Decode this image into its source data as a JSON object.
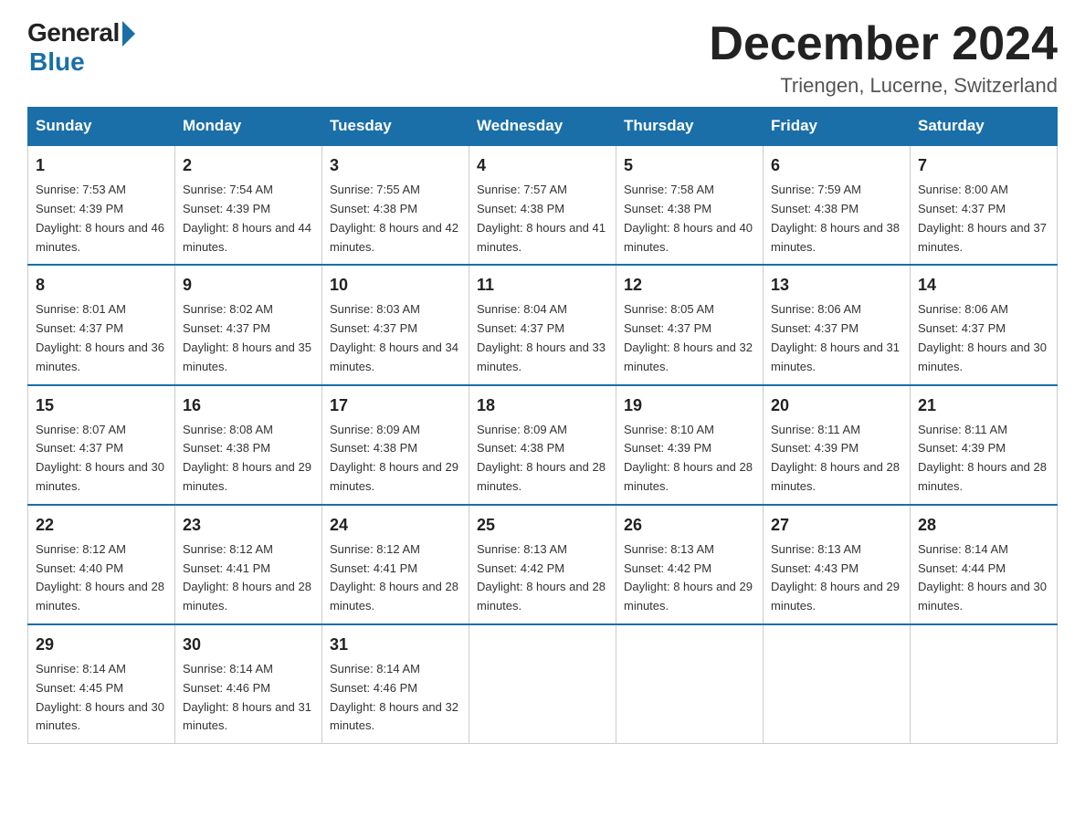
{
  "header": {
    "logo_general": "General",
    "logo_blue": "Blue",
    "month_title": "December 2024",
    "location": "Triengen, Lucerne, Switzerland"
  },
  "weekdays": [
    "Sunday",
    "Monday",
    "Tuesday",
    "Wednesday",
    "Thursday",
    "Friday",
    "Saturday"
  ],
  "weeks": [
    [
      {
        "day": "1",
        "sunrise": "7:53 AM",
        "sunset": "4:39 PM",
        "daylight": "8 hours and 46 minutes."
      },
      {
        "day": "2",
        "sunrise": "7:54 AM",
        "sunset": "4:39 PM",
        "daylight": "8 hours and 44 minutes."
      },
      {
        "day": "3",
        "sunrise": "7:55 AM",
        "sunset": "4:38 PM",
        "daylight": "8 hours and 42 minutes."
      },
      {
        "day": "4",
        "sunrise": "7:57 AM",
        "sunset": "4:38 PM",
        "daylight": "8 hours and 41 minutes."
      },
      {
        "day": "5",
        "sunrise": "7:58 AM",
        "sunset": "4:38 PM",
        "daylight": "8 hours and 40 minutes."
      },
      {
        "day": "6",
        "sunrise": "7:59 AM",
        "sunset": "4:38 PM",
        "daylight": "8 hours and 38 minutes."
      },
      {
        "day": "7",
        "sunrise": "8:00 AM",
        "sunset": "4:37 PM",
        "daylight": "8 hours and 37 minutes."
      }
    ],
    [
      {
        "day": "8",
        "sunrise": "8:01 AM",
        "sunset": "4:37 PM",
        "daylight": "8 hours and 36 minutes."
      },
      {
        "day": "9",
        "sunrise": "8:02 AM",
        "sunset": "4:37 PM",
        "daylight": "8 hours and 35 minutes."
      },
      {
        "day": "10",
        "sunrise": "8:03 AM",
        "sunset": "4:37 PM",
        "daylight": "8 hours and 34 minutes."
      },
      {
        "day": "11",
        "sunrise": "8:04 AM",
        "sunset": "4:37 PM",
        "daylight": "8 hours and 33 minutes."
      },
      {
        "day": "12",
        "sunrise": "8:05 AM",
        "sunset": "4:37 PM",
        "daylight": "8 hours and 32 minutes."
      },
      {
        "day": "13",
        "sunrise": "8:06 AM",
        "sunset": "4:37 PM",
        "daylight": "8 hours and 31 minutes."
      },
      {
        "day": "14",
        "sunrise": "8:06 AM",
        "sunset": "4:37 PM",
        "daylight": "8 hours and 30 minutes."
      }
    ],
    [
      {
        "day": "15",
        "sunrise": "8:07 AM",
        "sunset": "4:37 PM",
        "daylight": "8 hours and 30 minutes."
      },
      {
        "day": "16",
        "sunrise": "8:08 AM",
        "sunset": "4:38 PM",
        "daylight": "8 hours and 29 minutes."
      },
      {
        "day": "17",
        "sunrise": "8:09 AM",
        "sunset": "4:38 PM",
        "daylight": "8 hours and 29 minutes."
      },
      {
        "day": "18",
        "sunrise": "8:09 AM",
        "sunset": "4:38 PM",
        "daylight": "8 hours and 28 minutes."
      },
      {
        "day": "19",
        "sunrise": "8:10 AM",
        "sunset": "4:39 PM",
        "daylight": "8 hours and 28 minutes."
      },
      {
        "day": "20",
        "sunrise": "8:11 AM",
        "sunset": "4:39 PM",
        "daylight": "8 hours and 28 minutes."
      },
      {
        "day": "21",
        "sunrise": "8:11 AM",
        "sunset": "4:39 PM",
        "daylight": "8 hours and 28 minutes."
      }
    ],
    [
      {
        "day": "22",
        "sunrise": "8:12 AM",
        "sunset": "4:40 PM",
        "daylight": "8 hours and 28 minutes."
      },
      {
        "day": "23",
        "sunrise": "8:12 AM",
        "sunset": "4:41 PM",
        "daylight": "8 hours and 28 minutes."
      },
      {
        "day": "24",
        "sunrise": "8:12 AM",
        "sunset": "4:41 PM",
        "daylight": "8 hours and 28 minutes."
      },
      {
        "day": "25",
        "sunrise": "8:13 AM",
        "sunset": "4:42 PM",
        "daylight": "8 hours and 28 minutes."
      },
      {
        "day": "26",
        "sunrise": "8:13 AM",
        "sunset": "4:42 PM",
        "daylight": "8 hours and 29 minutes."
      },
      {
        "day": "27",
        "sunrise": "8:13 AM",
        "sunset": "4:43 PM",
        "daylight": "8 hours and 29 minutes."
      },
      {
        "day": "28",
        "sunrise": "8:14 AM",
        "sunset": "4:44 PM",
        "daylight": "8 hours and 30 minutes."
      }
    ],
    [
      {
        "day": "29",
        "sunrise": "8:14 AM",
        "sunset": "4:45 PM",
        "daylight": "8 hours and 30 minutes."
      },
      {
        "day": "30",
        "sunrise": "8:14 AM",
        "sunset": "4:46 PM",
        "daylight": "8 hours and 31 minutes."
      },
      {
        "day": "31",
        "sunrise": "8:14 AM",
        "sunset": "4:46 PM",
        "daylight": "8 hours and 32 minutes."
      },
      null,
      null,
      null,
      null
    ]
  ]
}
